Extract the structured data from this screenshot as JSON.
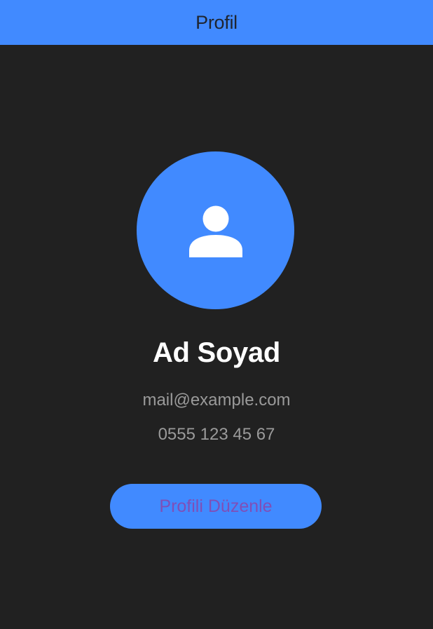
{
  "app_bar": {
    "title": "Profil"
  },
  "avatar": {
    "icon": "person-icon"
  },
  "profile": {
    "name": "Ad Soyad",
    "email": "mail@example.com",
    "phone": "0555 123 45 67"
  },
  "actions": {
    "edit_profile_label": "Profili Düzenle"
  },
  "colors": {
    "background": "#212121",
    "accent": "#418aff",
    "button_text": "#7f4fb7",
    "secondary_text": "#9a9a9a"
  }
}
